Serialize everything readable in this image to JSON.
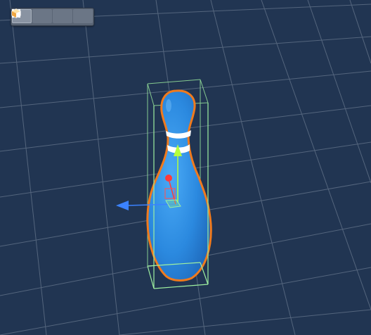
{
  "viewport": {
    "background": "#213552",
    "grid_color": "#5d6e85"
  },
  "toolbar": {
    "buttons": [
      {
        "name": "perspective-view-button",
        "icon": "cube-outline-icon",
        "active": true
      },
      {
        "name": "bounding-box-button",
        "icon": "bounding-box-icon",
        "active": false
      },
      {
        "name": "wireframe-cube-button",
        "icon": "cube-wireframe-icon",
        "active": false
      },
      {
        "name": "shaded-cube-button",
        "icon": "cube-shaded-icon",
        "active": false
      }
    ]
  },
  "scene": {
    "object": "bowling-pin",
    "object_color": "#2e8fe6",
    "selection_outline_color": "#f07a1d",
    "bounding_box_color": "#9ff0a0",
    "gizmo": {
      "x_axis_color": "#ff3b3b",
      "y_axis_color": "#b6ff3c",
      "z_axis_color": "#3b82ff"
    }
  }
}
